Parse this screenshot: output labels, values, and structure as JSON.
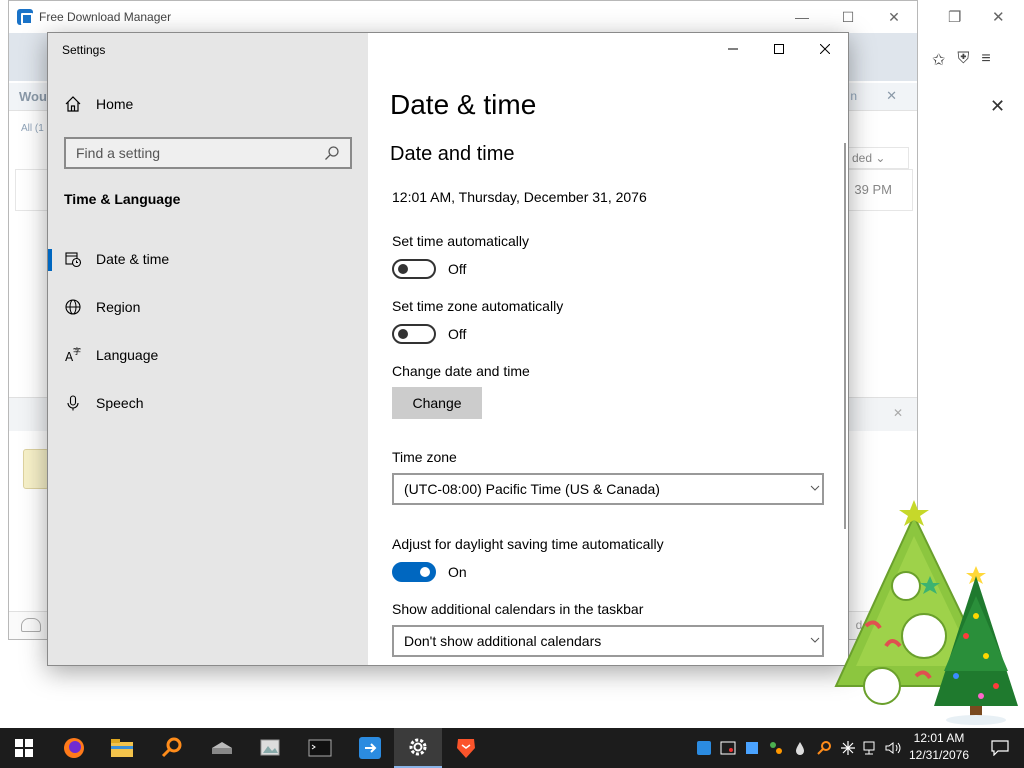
{
  "fdm": {
    "title": "Free Download Manager",
    "row_text": "Woul",
    "row_right": "n",
    "filter_text": "All (1",
    "sort_label": "ded",
    "item_time": "39 PM",
    "bottom_text": "de"
  },
  "settings": {
    "window_title": "Settings",
    "nav": {
      "home": "Home",
      "search_placeholder": "Find a setting",
      "section": "Time & Language",
      "items": [
        {
          "label": "Date & time",
          "icon": "calendar-clock-icon",
          "active": true
        },
        {
          "label": "Region",
          "icon": "globe-icon"
        },
        {
          "label": "Language",
          "icon": "language-icon"
        },
        {
          "label": "Speech",
          "icon": "microphone-icon"
        }
      ]
    },
    "page_title": "Date & time",
    "section_title": "Date and time",
    "current_datetime": "12:01 AM, Thursday, December 31, 2076",
    "set_time_auto": {
      "label": "Set time automatically",
      "state": "Off"
    },
    "set_timezone_auto": {
      "label": "Set time zone automatically",
      "state": "Off"
    },
    "change_datetime": {
      "label": "Change date and time",
      "button": "Change"
    },
    "time_zone": {
      "label": "Time zone",
      "value": "(UTC-08:00) Pacific Time (US & Canada)"
    },
    "dst": {
      "label": "Adjust for daylight saving time automatically",
      "state": "On"
    },
    "calendars": {
      "label": "Show additional calendars in the taskbar",
      "value": "Don't show additional calendars"
    }
  },
  "taskbar": {
    "apps": [
      "windows-start",
      "firefox",
      "file-explorer",
      "search-tool",
      "drive-app",
      "photos-app",
      "terminal",
      "free-download-manager",
      "settings",
      "brave"
    ],
    "clock_time": "12:01 AM",
    "clock_date": "12/31/2076"
  },
  "colors": {
    "accent": "#0067c0",
    "nav_bg": "#e6e6e6",
    "taskbar_bg": "#1c1c1c"
  }
}
